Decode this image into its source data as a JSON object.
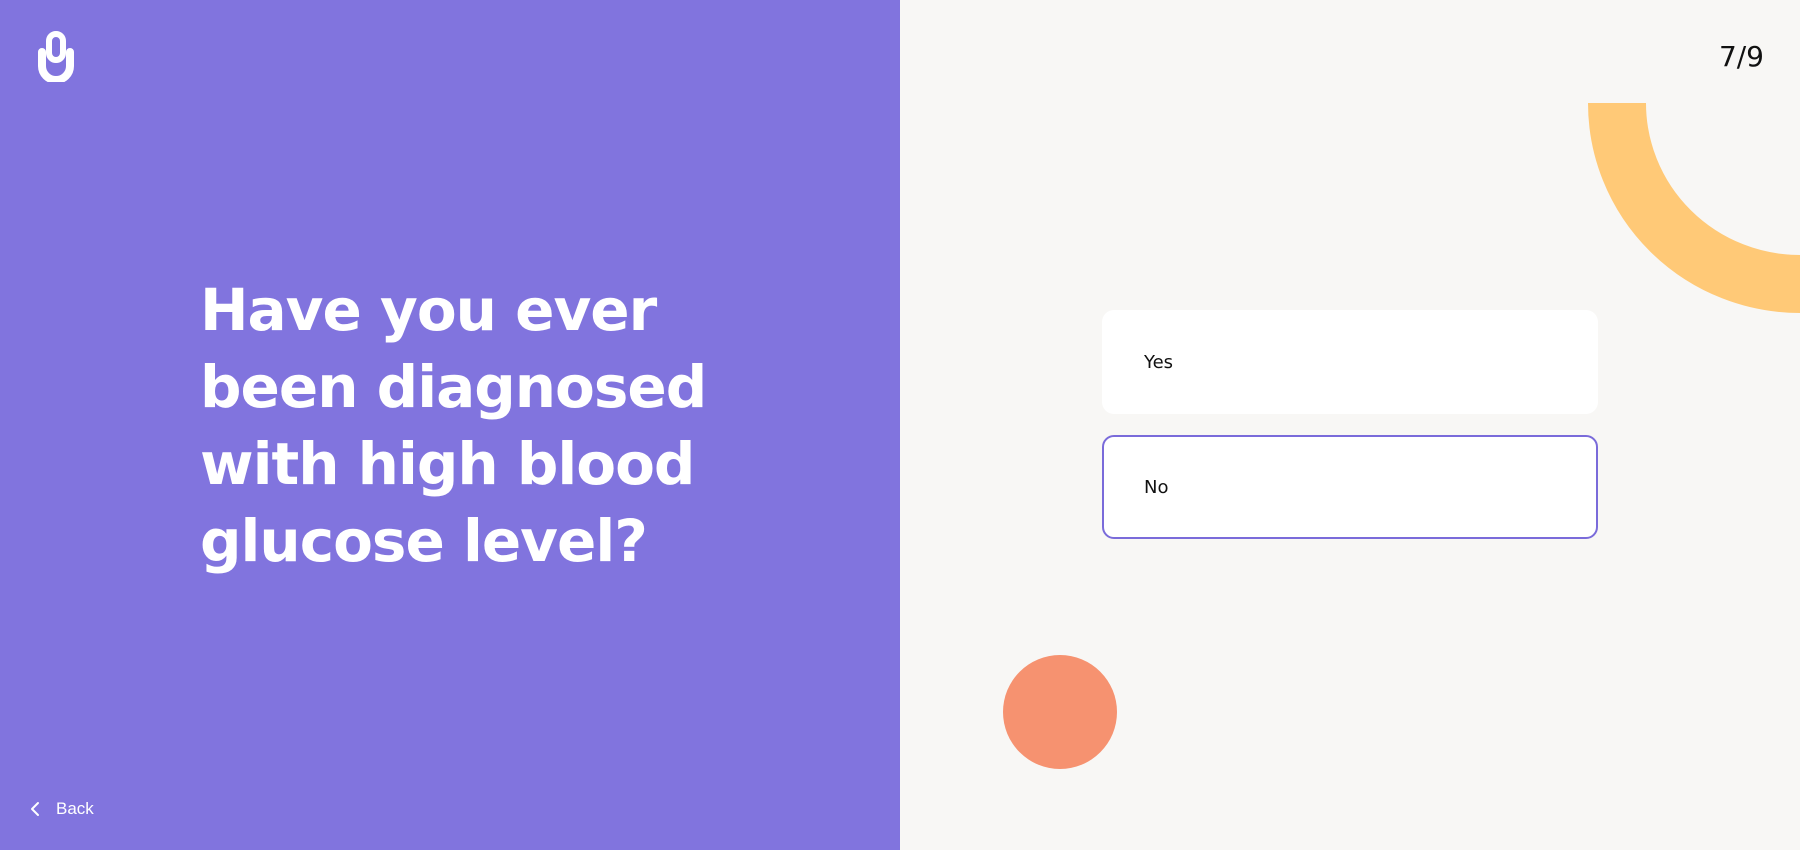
{
  "question": {
    "text": "Have you ever been diagnosed with high blood glucose level?"
  },
  "navigation": {
    "back_label": "Back",
    "back_icon": "chevron-left-icon"
  },
  "progress": {
    "counter": "7/9",
    "current": 7,
    "total": 9
  },
  "options": [
    {
      "label": "Yes",
      "selected": false
    },
    {
      "label": "No",
      "selected": true
    }
  ],
  "logo": {
    "icon": "logo-icon"
  },
  "colors": {
    "left_panel": "#8174DE",
    "right_panel": "#F8F7F5",
    "selected_border": "#7A6BDA",
    "arc_decoration": "#FFC977",
    "circle_decoration": "#F69270"
  }
}
